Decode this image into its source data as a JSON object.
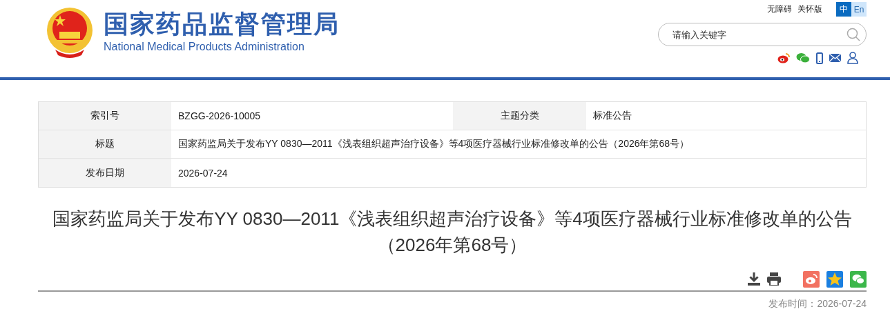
{
  "header": {
    "title_cn": "国家药品监督管理局",
    "title_en": "National Medical Products Administration",
    "top_links": [
      "无障碍",
      "关怀版"
    ],
    "languages": [
      {
        "label": "中",
        "selected": true
      },
      {
        "label": "En",
        "selected": false
      }
    ],
    "search": {
      "placeholder": "请输入关键字"
    }
  },
  "info_table": {
    "rows": [
      [
        {
          "label": "索引号",
          "value": "BZGG-2026-10005"
        },
        {
          "label": "主题分类",
          "value": "标准公告"
        }
      ],
      [
        {
          "label": "标题",
          "value": "国家药监局关于发布YY 0830—2011《浅表组织超声治疗设备》等4项医疗器械行业标准修改单的公告（2026年第68号）"
        }
      ],
      [
        {
          "label": "发布日期",
          "value": "2026-07-24"
        }
      ]
    ]
  },
  "article": {
    "title": "国家药监局关于发布YY 0830—2011《浅表组织超声治疗设备》等4项医疗器械行业标准修改单的公告（2026年第68号）",
    "publish_time": "发布时间：2026-07-24"
  }
}
